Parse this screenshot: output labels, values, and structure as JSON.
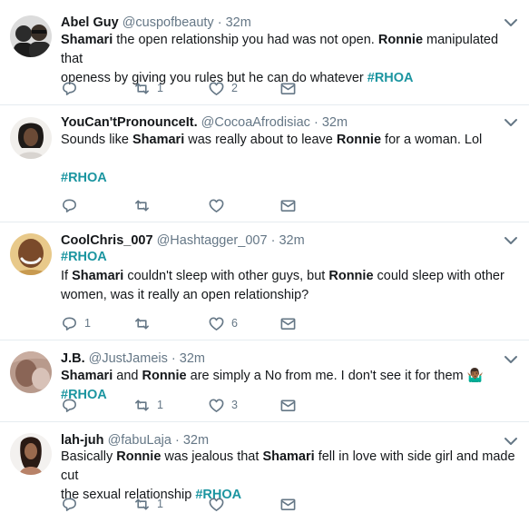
{
  "tweets": [
    {
      "name": "Abel Guy",
      "handle": "@cuspofbeauty",
      "time": "32m",
      "lines": [
        [
          {
            "b": "Shamari"
          },
          {
            "t": " the open relationship you had was not open. "
          },
          {
            "b": "Ronnie"
          },
          {
            "t": " manipulated that"
          }
        ],
        [
          {
            "t": "openess by giving you rules but he can do whatever "
          },
          {
            "h": "#RHOA"
          }
        ]
      ],
      "replies": "",
      "retweets": "1",
      "likes": "2"
    },
    {
      "name": "YouCan'tPronounceIt.",
      "handle": "@CocoaAfrodisiac",
      "time": "32m",
      "lines": [
        [
          {
            "t": "Sounds like "
          },
          {
            "b": "Shamari"
          },
          {
            "t": " was really about to leave "
          },
          {
            "b": "Ronnie"
          },
          {
            "t": " for a woman. Lol"
          }
        ],
        [],
        [
          {
            "h": "#RHOA"
          }
        ]
      ],
      "replies": "",
      "retweets": "",
      "likes": ""
    },
    {
      "name": "CoolChris_007",
      "handle": "@Hashtagger_007",
      "time": "32m",
      "lines": [
        [
          {
            "h": "#RHOA"
          }
        ],
        [
          {
            "t": "If "
          },
          {
            "b": "Shamari"
          },
          {
            "t": " couldn't sleep with other guys, but "
          },
          {
            "b": "Ronnie"
          },
          {
            "t": " could sleep with other"
          }
        ],
        [
          {
            "t": "women, was it really an open relationship?"
          }
        ]
      ],
      "replies": "1",
      "retweets": "",
      "likes": "6"
    },
    {
      "name": "J.B.",
      "handle": "@JustJameis",
      "time": "32m",
      "lines": [
        [
          {
            "b": "Shamari"
          },
          {
            "t": " and "
          },
          {
            "b": "Ronnie"
          },
          {
            "t": " are simply a No from me. I don't see it for them "
          },
          {
            "e": "🤷🏾‍♂️"
          },
          {
            "t": " "
          },
          {
            "h": "#RHOA"
          }
        ]
      ],
      "replies": "",
      "retweets": "1",
      "likes": "3"
    },
    {
      "name": "lah-juh",
      "handle": "@fabuLaja",
      "time": "32m",
      "lines": [
        [
          {
            "t": "Basically "
          },
          {
            "b": "Ronnie"
          },
          {
            "t": " was jealous that "
          },
          {
            "b": "Shamari"
          },
          {
            "t": " fell in love with side girl and made cut"
          }
        ],
        [
          {
            "t": "the sexual relationship "
          },
          {
            "h": "#RHOA"
          }
        ]
      ],
      "replies": "",
      "retweets": "1",
      "likes": ""
    }
  ],
  "icons": {
    "reply": "reply-icon",
    "retweet": "retweet-icon",
    "like": "heart-icon",
    "dm": "envelope-icon",
    "menu": "chevron-down-icon"
  },
  "colors": {
    "hashtag": "#1b95a0",
    "muted": "#657786",
    "border": "#e6ecf0"
  }
}
